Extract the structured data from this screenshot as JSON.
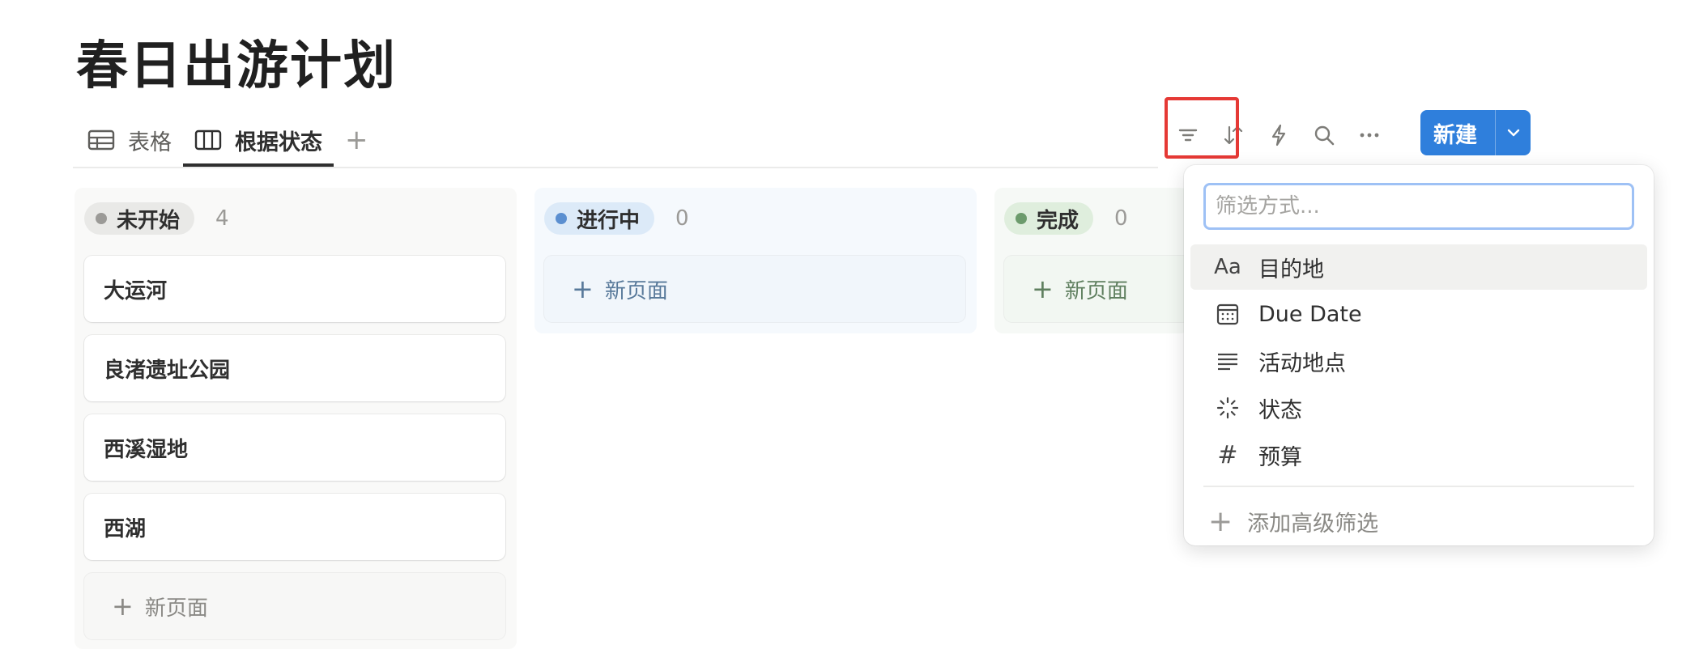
{
  "page": {
    "title": "春日出游计划"
  },
  "tabs": [
    {
      "label": "表格",
      "icon": "table-icon"
    },
    {
      "label": "根据状态",
      "icon": "board-icon",
      "active": true
    }
  ],
  "toolbar": {
    "new_label": "新建",
    "icons": [
      "filter-icon",
      "sort-icon",
      "automation-icon",
      "search-icon",
      "more-icon"
    ]
  },
  "columns": [
    {
      "status": "未开始",
      "count": "4",
      "dot_color": "#9b9a97",
      "pill_bg": "#e9e9e7",
      "cards": [
        "大运河",
        "良渚遗址公园",
        "西溪湿地",
        "西湖"
      ],
      "new_page": "新页面"
    },
    {
      "status": "进行中",
      "count": "0",
      "dot_color": "#5b8fd0",
      "pill_bg": "#dceaf8",
      "new_page": "新页面"
    },
    {
      "status": "完成",
      "count": "0",
      "dot_color": "#6c9b6c",
      "pill_bg": "#dfeedd",
      "new_page": "新页面"
    }
  ],
  "filter_menu": {
    "placeholder": "筛选方式...",
    "items": [
      {
        "label": "目的地",
        "icon": "text-property-icon"
      },
      {
        "label": "Due Date",
        "icon": "calendar-icon"
      },
      {
        "label": "活动地点",
        "icon": "lines-icon"
      },
      {
        "label": "状态",
        "icon": "status-spinner-icon"
      },
      {
        "label": "预算",
        "icon": "number-hash-icon"
      }
    ],
    "advanced": "添加高级筛选"
  },
  "colors": {
    "accent": "#2f7fdc",
    "highlight": "#e53935"
  }
}
